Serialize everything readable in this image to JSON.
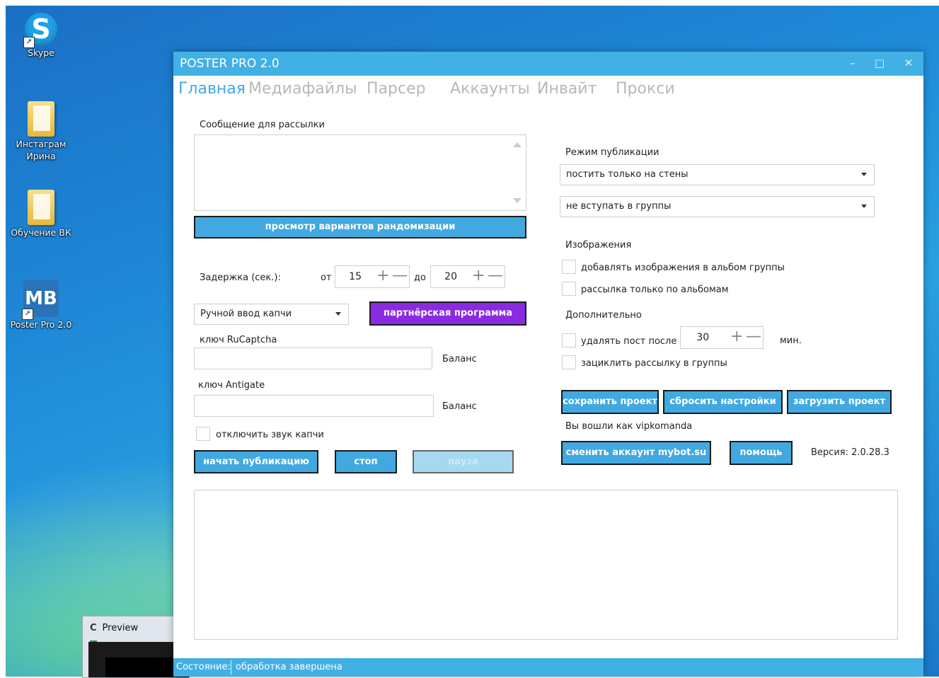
{
  "desktop": {
    "icons": [
      {
        "label": "Skype",
        "glyph": "S"
      },
      {
        "label": "Инстаграм Ирина"
      },
      {
        "label": "Обучение ВК"
      },
      {
        "label": "Poster Pro 2.0",
        "glyph": "MB"
      }
    ],
    "preview_window_title": "Preview"
  },
  "window": {
    "title": "POSTER PRO 2.0",
    "controls": {
      "minimize": "–",
      "maximize": "□",
      "close": "✕"
    }
  },
  "tabs": [
    "Главная",
    "Медиафайлы",
    "Парсер",
    "Аккаунты",
    "Инвайт",
    "Прокси"
  ],
  "left": {
    "message_label": "Сообщение для рассылки",
    "message_value": "",
    "randomization_button": "просмотр вариантов рандомизации",
    "delay_label": "Задержка  (сек.):",
    "from_label": "от",
    "from_value": "15",
    "to_label": "до",
    "to_value": "20",
    "captcha_select": "Ручной ввод капчи",
    "partner_button": "партнёрская программа",
    "rucaptcha_label": "ключ RuCaptcha",
    "rucaptcha_value": "",
    "balance_label_1": "Баланс",
    "antigate_label": "ключ Antigate",
    "antigate_value": "",
    "balance_label_2": "Баланс",
    "mute_captcha_label": "отключить звук капчи",
    "start_button": "начать публикацию",
    "stop_button": "стоп",
    "pause_button": "пауза"
  },
  "right": {
    "mode_label": "Режим публикации",
    "mode_select": "постить только на стены",
    "join_select": "не вступать в группы",
    "images_label": "Изображения",
    "add_images_label": "добавлять изображения в альбом группы",
    "albums_only_label": "рассылка только по альбомам",
    "extra_label": "Дополнительно",
    "delete_post_label": "удалять пост после",
    "delete_after_value": "30",
    "minutes_label": "мин.",
    "loop_label": "зациклить рассылку в группы",
    "save_button": "сохранить проект",
    "reset_button": "сбросить настройки",
    "load_button": "загрузить проект",
    "logged_in_text": "Вы вошли как vipkomanda",
    "change_account_button": "сменить аккаунт mybot.su",
    "help_button": "помощь",
    "version_text": "Версия: 2.0.28.3"
  },
  "log": "",
  "status": {
    "label": "Состояние:",
    "value": "обработка завершена"
  }
}
